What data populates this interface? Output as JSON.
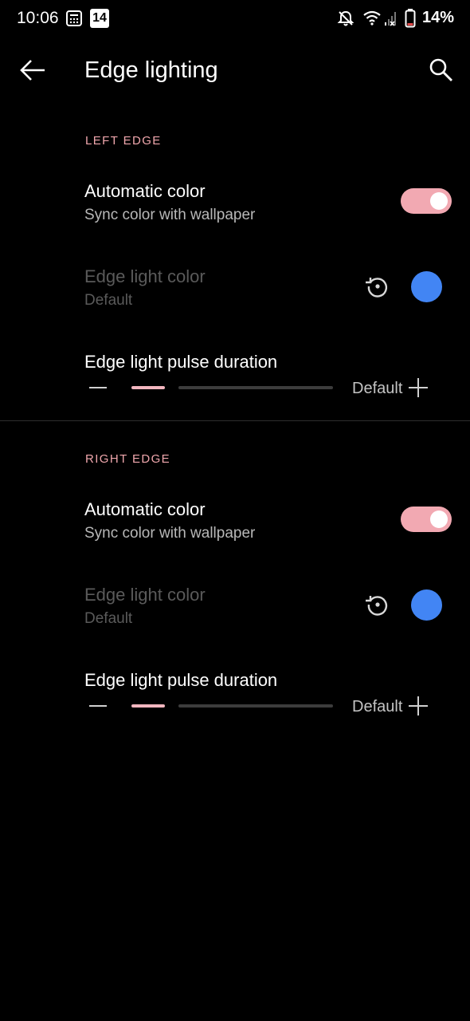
{
  "status_bar": {
    "time": "10:06",
    "calendar_badge": "14",
    "battery_percent": "14%",
    "icons": [
      "calculator-icon",
      "calendar-icon",
      "bell-off-icon",
      "wifi-icon",
      "signal-icon",
      "battery-icon"
    ]
  },
  "app_bar": {
    "title": "Edge lighting",
    "back_icon": "arrow-left-icon",
    "search_icon": "search-icon"
  },
  "left_edge": {
    "header": "LEFT EDGE",
    "auto_color": {
      "title": "Automatic color",
      "subtitle": "Sync color with wallpaper",
      "enabled": true
    },
    "edge_color": {
      "title": "Edge light color",
      "subtitle": "Default",
      "color": "#4285f4"
    },
    "pulse": {
      "title": "Edge light pulse duration",
      "value_label": "Default"
    }
  },
  "right_edge": {
    "header": "RIGHT EDGE",
    "auto_color": {
      "title": "Automatic color",
      "subtitle": "Sync color with wallpaper",
      "enabled": true
    },
    "edge_color": {
      "title": "Edge light color",
      "subtitle": "Default",
      "color": "#4285f4"
    },
    "pulse": {
      "title": "Edge light pulse duration",
      "value_label": "Default"
    }
  },
  "colors": {
    "accent": "#f2a9b2",
    "header": "#f0a7ad",
    "swatch": "#4285f4"
  }
}
